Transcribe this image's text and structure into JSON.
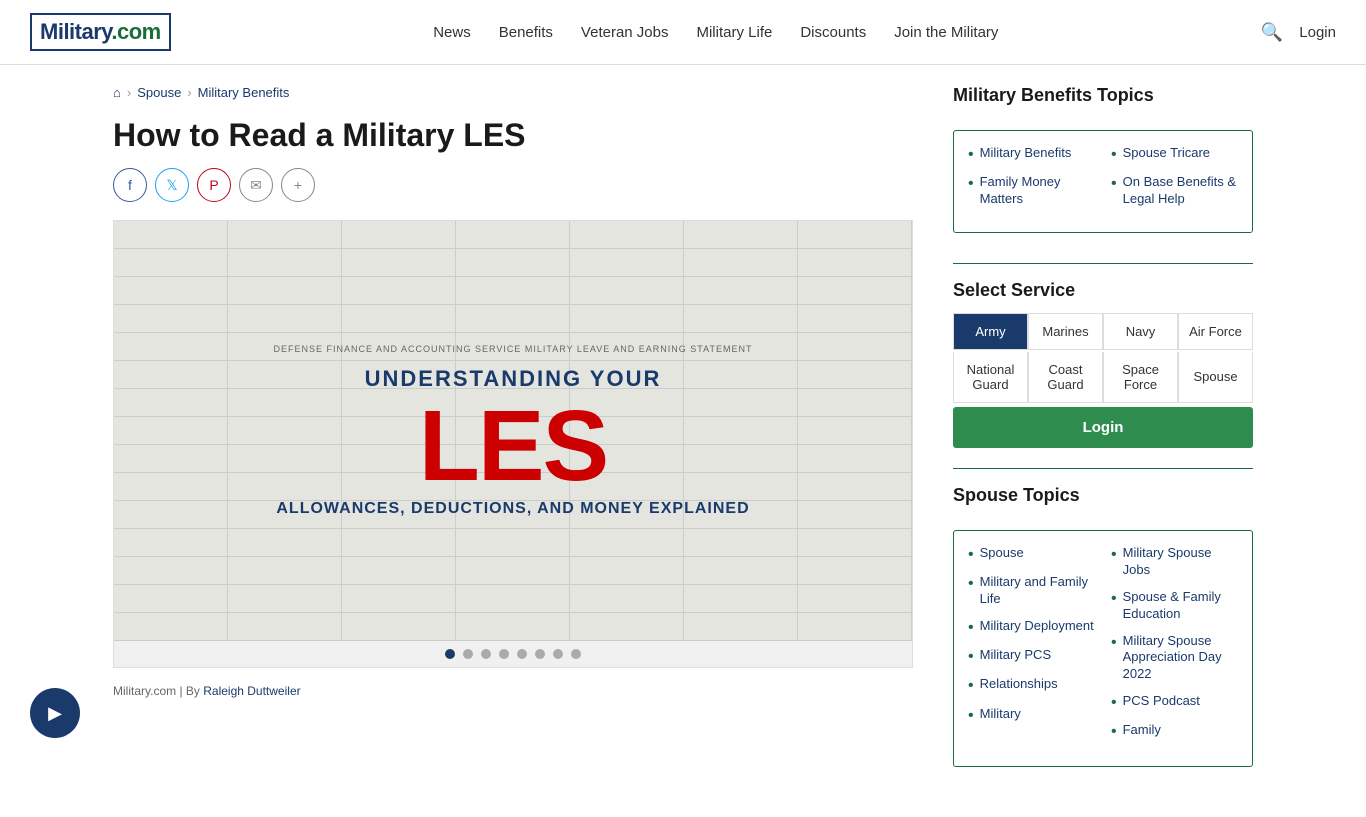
{
  "header": {
    "logo_text": "Military",
    "logo_dot": ".com",
    "nav": [
      {
        "label": "News",
        "id": "news"
      },
      {
        "label": "Benefits",
        "id": "benefits"
      },
      {
        "label": "Veteran Jobs",
        "id": "veteran-jobs"
      },
      {
        "label": "Military Life",
        "id": "military-life"
      },
      {
        "label": "Discounts",
        "id": "discounts"
      },
      {
        "label": "Join the Military",
        "id": "join"
      }
    ],
    "login_label": "Login"
  },
  "breadcrumb": {
    "home_icon": "⌂",
    "items": [
      "Spouse",
      "Military Benefits"
    ]
  },
  "article": {
    "title": "How to Read a Military LES",
    "image_header": "DEFENSE FINANCE AND ACCOUNTING SERVICE MILITARY LEAVE AND EARNING STATEMENT",
    "image_title": "UNDERSTANDING YOUR",
    "image_main": "LES",
    "image_subtitle": "ALLOWANCES, DEDUCTIONS, AND MONEY EXPLAINED",
    "author_prefix": "Military.com | By ",
    "author_name": "Raleigh Duttweiler"
  },
  "social": {
    "buttons": [
      {
        "label": "f",
        "type": "facebook",
        "title": "Share on Facebook"
      },
      {
        "label": "t",
        "type": "twitter",
        "title": "Share on Twitter"
      },
      {
        "label": "P",
        "type": "pinterest",
        "title": "Share on Pinterest"
      },
      {
        "label": "✉",
        "type": "email",
        "title": "Share via Email"
      },
      {
        "label": "+",
        "type": "more",
        "title": "More sharing options"
      }
    ]
  },
  "carousel": {
    "dots": [
      1,
      2,
      3,
      4,
      5,
      6,
      7,
      8
    ],
    "active": 1
  },
  "sidebar": {
    "benefits_topics": {
      "title": "Military Benefits Topics",
      "col1": [
        {
          "label": "Military Benefits",
          "href": "#"
        },
        {
          "label": "Family Money Matters",
          "href": "#"
        }
      ],
      "col2": [
        {
          "label": "Spouse Tricare",
          "href": "#"
        },
        {
          "label": "On Base Benefits & Legal Help",
          "href": "#"
        }
      ]
    },
    "select_service": {
      "title": "Select Service",
      "row1": [
        {
          "label": "Army",
          "id": "army",
          "active": true
        },
        {
          "label": "Marines",
          "id": "marines"
        },
        {
          "label": "Navy",
          "id": "navy"
        },
        {
          "label": "Air Force",
          "id": "air-force"
        }
      ],
      "row2": [
        {
          "label": "National Guard",
          "id": "national-guard"
        },
        {
          "label": "Coast Guard",
          "id": "coast-guard"
        },
        {
          "label": "Space Force",
          "id": "space-force"
        },
        {
          "label": "Spouse",
          "id": "spouse"
        }
      ],
      "login_label": "Login"
    },
    "spouse_topics": {
      "title": "Spouse Topics",
      "col1": [
        {
          "label": "Spouse",
          "href": "#"
        },
        {
          "label": "Military and Family Life",
          "href": "#"
        },
        {
          "label": "Military Deployment",
          "href": "#"
        },
        {
          "label": "Military PCS",
          "href": "#"
        },
        {
          "label": "Relationships",
          "href": "#"
        },
        {
          "label": "Military",
          "href": "#"
        }
      ],
      "col2": [
        {
          "label": "Military Spouse Jobs",
          "href": "#"
        },
        {
          "label": "Spouse & Family Education",
          "href": "#"
        },
        {
          "label": "Military Spouse Appreciation Day 2022",
          "href": "#"
        },
        {
          "label": "PCS Podcast",
          "href": "#"
        },
        {
          "label": "Family",
          "href": "#"
        }
      ]
    }
  }
}
